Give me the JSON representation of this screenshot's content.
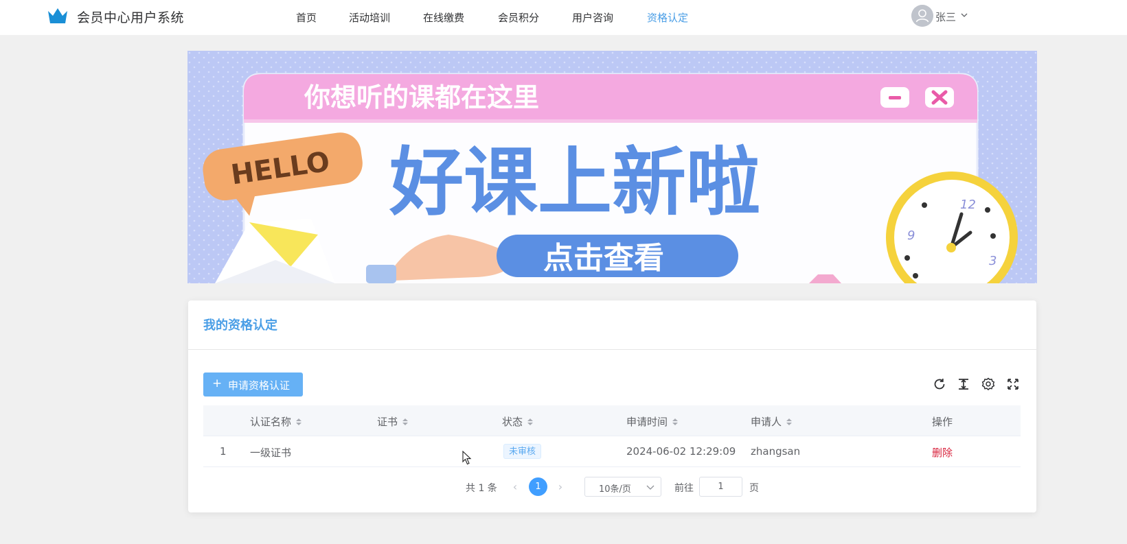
{
  "header": {
    "brand": "会员中心用户系统",
    "nav": [
      "首页",
      "活动培训",
      "在线缴费",
      "会员积分",
      "用户咨询",
      "资格认定"
    ],
    "active_nav": "资格认定",
    "user_name": "张三"
  },
  "banner": {
    "window_title": "你想听的课都在这里",
    "headline": "好课上新啦",
    "button": "点击查看",
    "hello": "HELLO",
    "clock_numbers": [
      "12",
      "3",
      "9"
    ]
  },
  "card": {
    "title": "我的资格认定",
    "apply_button": "申请资格认证",
    "toolbar_icons": [
      "refresh-icon",
      "column-height-icon",
      "settings-icon",
      "fullscreen-icon"
    ]
  },
  "table": {
    "columns": [
      "认证名称",
      "证书",
      "状态",
      "申请时间",
      "申请人",
      "操作"
    ],
    "rows": [
      {
        "index": "1",
        "name": "一级证书",
        "certificate": "",
        "status": "未审核",
        "apply_time": "2024-06-02 12:29:09",
        "applicant": "zhangsan",
        "action": "删除"
      }
    ]
  },
  "pagination": {
    "total": "共 1 条",
    "current_page": "1",
    "page_size": "10条/页",
    "goto_label": "前往",
    "goto_value": "1",
    "page_suffix": "页"
  },
  "colors": {
    "accent": "#4a9ee6",
    "primary_button": "#66b1f5",
    "danger": "#d8233d",
    "banner_bg": "#bcc8f5",
    "banner_pink": "#f4a9e0",
    "banner_blue": "#5b8fe3"
  }
}
